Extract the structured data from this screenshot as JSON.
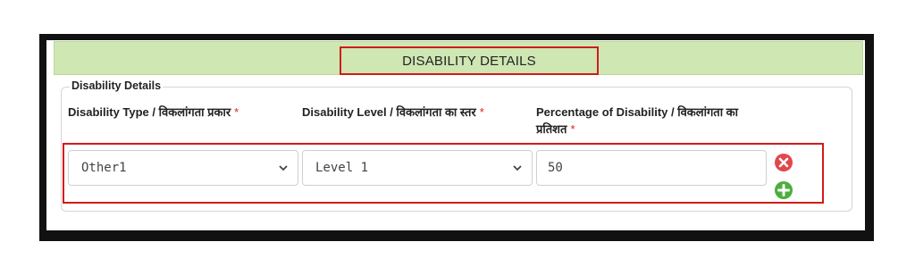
{
  "header": {
    "title": "DISABILITY DETAILS"
  },
  "section": {
    "legend": "Disability Details"
  },
  "columns": [
    {
      "label": "Disability Type / विकलांगता प्रकार",
      "required_mark": "*"
    },
    {
      "label": "Disability Level / विकलांगता का स्तर",
      "required_mark": "*"
    },
    {
      "label": "Percentage of Disability / विकलांगता का प्रतिशत",
      "required_mark": "*"
    }
  ],
  "row": {
    "disability_type": "Other1",
    "disability_level": "Level 1",
    "percentage": "50"
  },
  "icons": {
    "remove": "remove-circle-icon",
    "add": "add-circle-icon"
  },
  "colors": {
    "header_bg": "#cfe7b3",
    "highlight_border": "#d11c1c",
    "remove": "#e0484c",
    "add": "#4caf3d"
  }
}
